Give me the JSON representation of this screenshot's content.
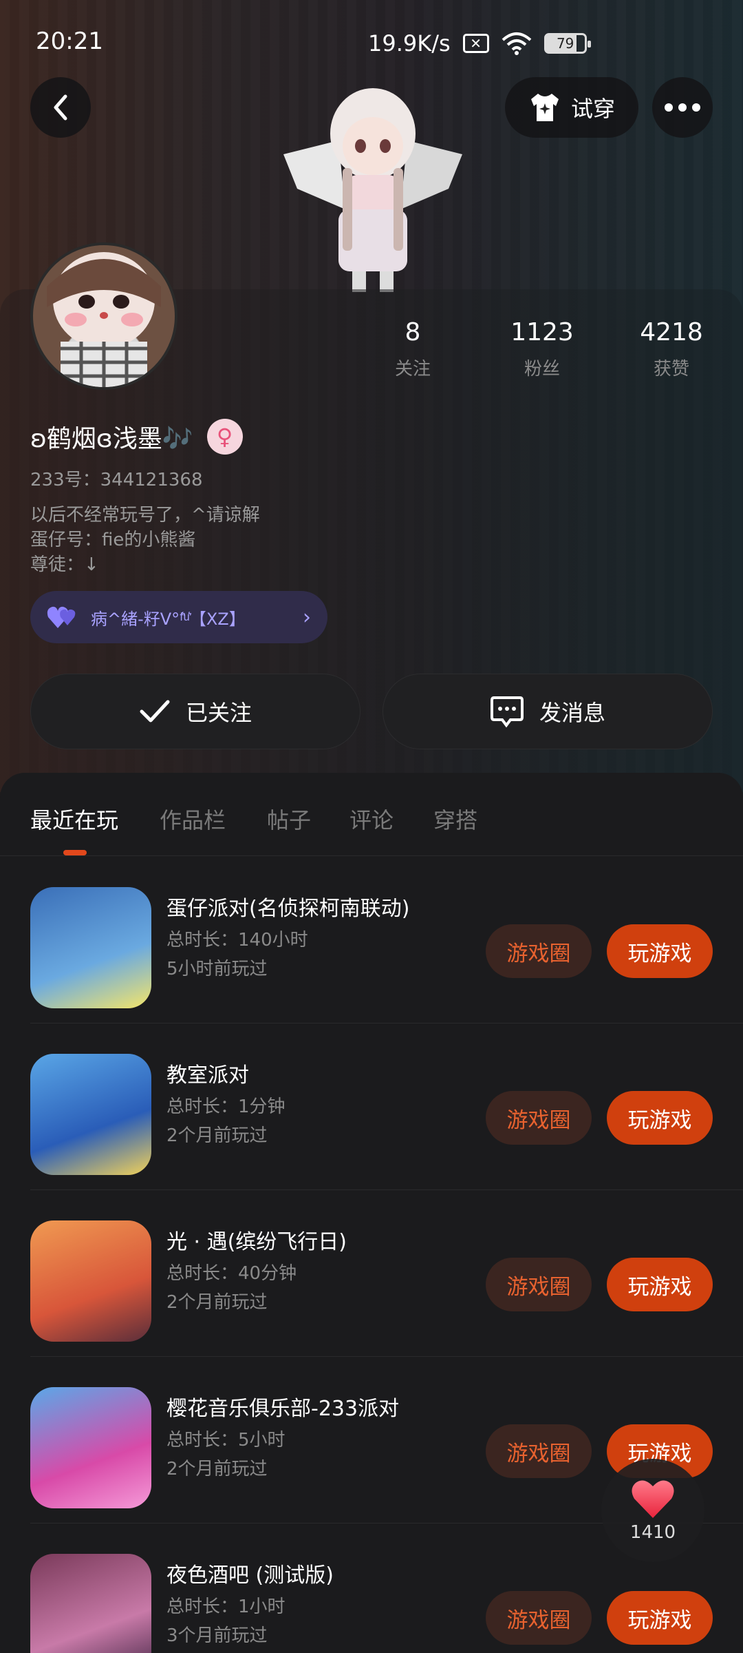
{
  "status_bar": {
    "time": "20:21",
    "net_speed": "19.9K/s",
    "battery": "79"
  },
  "header": {
    "tryon_label": "试穿"
  },
  "profile": {
    "stats": [
      {
        "value": "8",
        "label": "关注"
      },
      {
        "value": "1123",
        "label": "粉丝"
      },
      {
        "value": "4218",
        "label": "获赞"
      }
    ],
    "name": "ʚ鹤烟ɞ浅墨🎶",
    "gender_symbol": "♀",
    "uid": "233号：344121368",
    "bio_lines": [
      "以后不经常玩号了，^请谅解",
      "蛋仔号：fie的小熊酱",
      "尊徒：↓"
    ],
    "cp_label": "病^緒-籽Ⅴ°ᶠ͛ᵘ͛【XZ】",
    "follow_label": "已关注",
    "message_label": "发消息"
  },
  "tabs": [
    "最近在玩",
    "作品栏",
    "帖子",
    "评论",
    "穿搭"
  ],
  "games": [
    {
      "title": "蛋仔派对(名侦探柯南联动)",
      "duration": "总时长：140小时",
      "last_played": "5小时前玩过",
      "circle_label": "游戏圈",
      "play_label": "玩游戏",
      "icon_colors": [
        "#3a6fb8",
        "#6aa9e0",
        "#f5e66a"
      ]
    },
    {
      "title": "教室派对",
      "duration": "总时长：1分钟",
      "last_played": "2个月前玩过",
      "circle_label": "游戏圈",
      "play_label": "玩游戏",
      "icon_colors": [
        "#5aa6e6",
        "#2a5db8",
        "#f2d25a"
      ]
    },
    {
      "title": "光 · 遇(缤纷飞行日)",
      "duration": "总时长：40分钟",
      "last_played": "2个月前玩过",
      "circle_label": "游戏圈",
      "play_label": "玩游戏",
      "icon_colors": [
        "#f09a52",
        "#d8563a",
        "#5a2e3a"
      ]
    },
    {
      "title": "樱花音乐俱乐部-233派对",
      "duration": "总时长：5小时",
      "last_played": "2个月前玩过",
      "circle_label": "游戏圈",
      "play_label": "玩游戏",
      "icon_colors": [
        "#5aa8e8",
        "#d84aa8",
        "#f59ad8"
      ]
    },
    {
      "title": "夜色酒吧 (测试版)",
      "duration": "总时长：1小时",
      "last_played": "3个月前玩过",
      "circle_label": "游戏圈",
      "play_label": "玩游戏",
      "icon_colors": [
        "#7a3a5a",
        "#c87aa8",
        "#4a2a4a"
      ]
    }
  ],
  "like_fab": {
    "count": "1410"
  },
  "colors": {
    "accent": "#d0400e",
    "accent_soft": "#3b2520",
    "cp_bg": "#302c4a",
    "cp_text": "#a9a2ff"
  }
}
